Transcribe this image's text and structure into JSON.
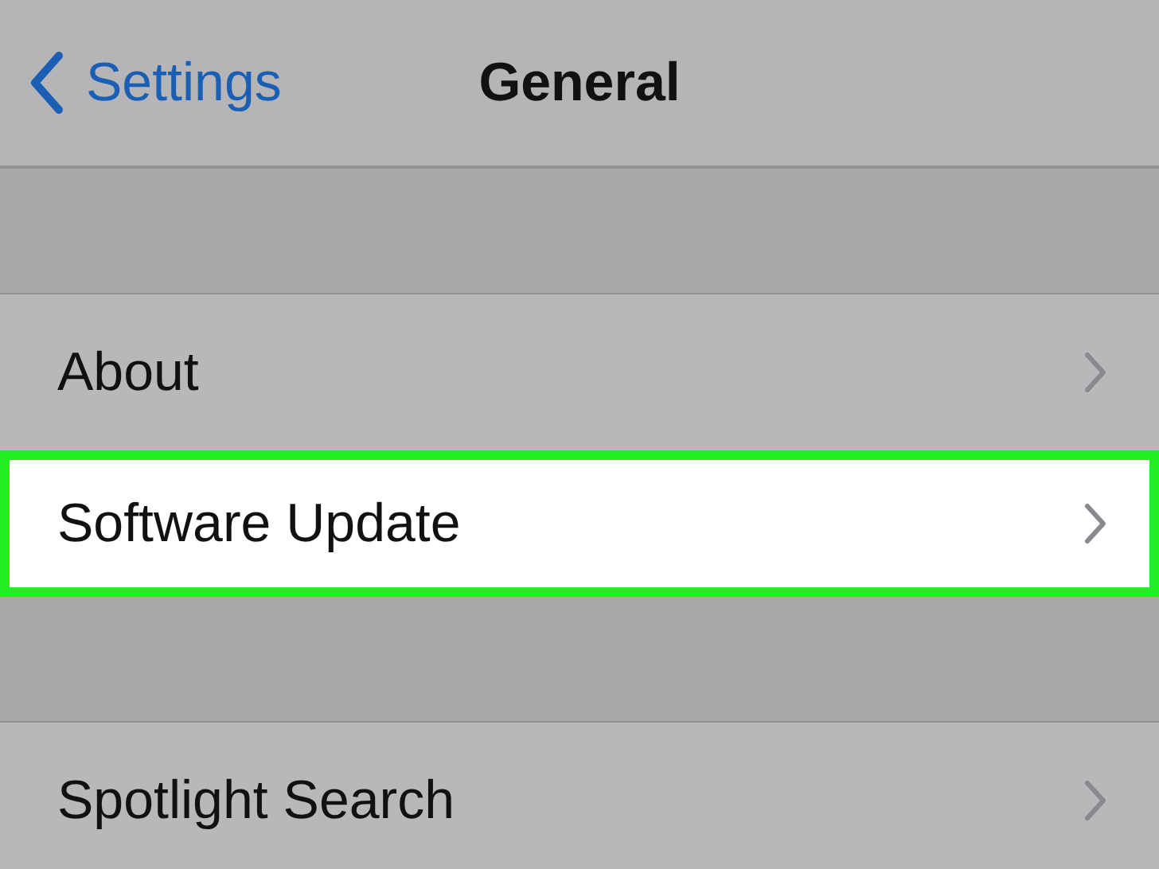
{
  "nav_bar": {
    "back_label": "Settings",
    "title": "General"
  },
  "groups": [
    {
      "rows": [
        {
          "label": "About",
          "highlighted": false
        },
        {
          "label": "Software Update",
          "highlighted": true
        }
      ]
    },
    {
      "rows": [
        {
          "label": "Spotlight Search",
          "highlighted": false
        }
      ]
    }
  ]
}
